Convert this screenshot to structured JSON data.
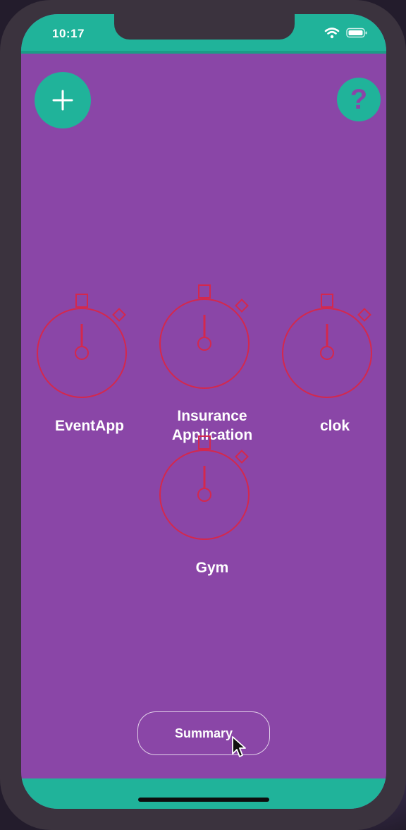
{
  "status_bar": {
    "time": "10:17",
    "icons": [
      "wifi-icon",
      "battery-icon"
    ]
  },
  "actions": {
    "add_icon": "plus-icon",
    "help_label": "?"
  },
  "timers": [
    {
      "name": "EventApp"
    },
    {
      "name": "Insurance Application"
    },
    {
      "name": "clok"
    },
    {
      "name": "Gym"
    }
  ],
  "summary_button": {
    "label": "Summary"
  },
  "colors": {
    "background": "#8a46a7",
    "accent": "#20b39a",
    "timer_stroke": "#d4284d",
    "text": "#ffffff"
  }
}
